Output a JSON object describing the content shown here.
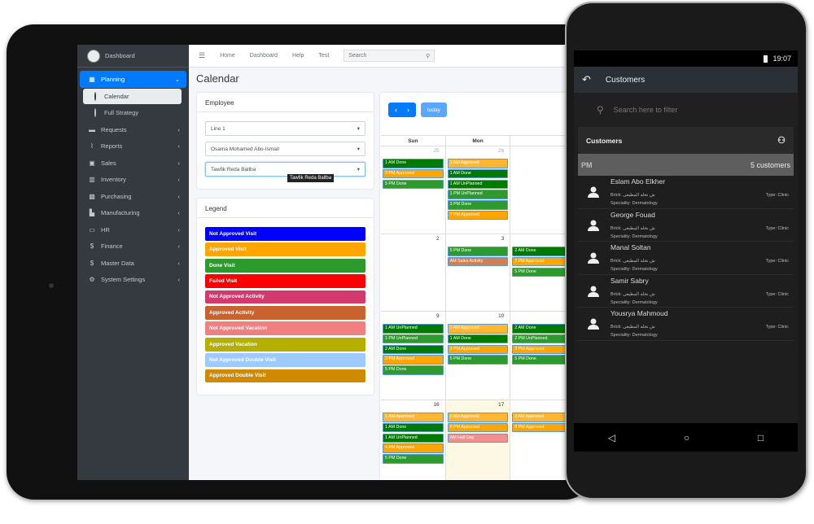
{
  "sidebar": {
    "brand": "Dashboard",
    "items": [
      {
        "label": "Planning",
        "icon": "calendar-icon",
        "glyph": "▦",
        "state": "active",
        "caret": "⌄"
      },
      {
        "label": "Calendar",
        "icon": "circle-icon",
        "state": "sub"
      },
      {
        "label": "Full Strategy",
        "icon": "circle-icon",
        "state": "sub2"
      },
      {
        "label": "Requests",
        "icon": "briefcase-icon",
        "glyph": "▬",
        "caret": "‹"
      },
      {
        "label": "Reports",
        "icon": "chart-icon",
        "glyph": "⌇",
        "caret": "‹"
      },
      {
        "label": "Sales",
        "icon": "id-card-icon",
        "glyph": "▣",
        "caret": "‹"
      },
      {
        "label": "Inventory",
        "icon": "barcode-icon",
        "glyph": "▥",
        "caret": "‹"
      },
      {
        "label": "Purchasing",
        "icon": "boxes-icon",
        "glyph": "▩",
        "caret": "‹"
      },
      {
        "label": "Manufacturing",
        "icon": "industry-icon",
        "glyph": "▙",
        "caret": "‹"
      },
      {
        "label": "HR",
        "icon": "chalkboard-user-icon",
        "glyph": "▭",
        "caret": "‹"
      },
      {
        "label": "Finance",
        "icon": "dollar-icon",
        "glyph": "$",
        "caret": "‹"
      },
      {
        "label": "Master Data",
        "icon": "dollar-icon",
        "glyph": "$",
        "caret": "‹"
      },
      {
        "label": "System Settings",
        "icon": "gear-icon",
        "glyph": "⚙",
        "caret": "‹"
      }
    ]
  },
  "topbar": {
    "links": [
      "Home",
      "Dashboard",
      "Help",
      "Test"
    ],
    "search_placeholder": "Search"
  },
  "page": {
    "title": "Calendar"
  },
  "employee": {
    "title": "Employee",
    "selects": [
      "Line 1",
      "Osama Mohamed Abo-Ismail",
      "Tawfik Reda Ballba"
    ],
    "tooltip": "Tawfik Reda Ballba"
  },
  "legend": {
    "title": "Legend",
    "items": [
      {
        "label": "Not Approved Visit",
        "color": "#0000ff"
      },
      {
        "label": "Approved Visit",
        "color": "#ffa500"
      },
      {
        "label": "Done Visit",
        "color": "#2e9a2e"
      },
      {
        "label": "Failed Visit",
        "color": "#ff0000"
      },
      {
        "label": "Not Approved Activity",
        "color": "#d23a6e"
      },
      {
        "label": "Approved Activity",
        "color": "#c8622e"
      },
      {
        "label": "Not Approved Vacation",
        "color": "#f08080"
      },
      {
        "label": "Approved Vacation",
        "color": "#b5b000"
      },
      {
        "label": "Not Approved Double Visit",
        "color": "#9ecbff"
      },
      {
        "label": "Approved Double Visit",
        "color": "#d08a00"
      }
    ]
  },
  "calendar": {
    "today_label": "today",
    "days": [
      "Sun",
      "Mon",
      ""
    ],
    "weeks": [
      {
        "height": 108,
        "days": [
          {
            "num": "25",
            "other": true,
            "events": [
              [
                "1 AM Done",
                "#007a00"
              ],
              [
                "3 PM Approved",
                "#ffa500"
              ],
              [
                "5 PM Done",
                "#2e9a2e"
              ]
            ]
          },
          {
            "num": "26",
            "other": true,
            "events": [
              [
                "1 AM Approved",
                "#ffb732"
              ],
              [
                "1 AM Done",
                "#007a00"
              ],
              [
                "1 AM UnPlanned",
                "#007a00"
              ],
              [
                "1 PM UnPlanned",
                "#2e9a2e"
              ],
              [
                "3 PM Done",
                "#2e9a2e"
              ],
              [
                "7 PM Approved",
                "#ffa500"
              ]
            ]
          },
          {
            "num": "",
            "events": []
          }
        ]
      },
      {
        "height": 95,
        "days": [
          {
            "num": "2",
            "events": []
          },
          {
            "num": "3",
            "events": [
              [
                "5 PM Done",
                "#2e9a2e"
              ],
              [
                "AM Sales Activity",
                "#d2804f"
              ]
            ]
          },
          {
            "num": "",
            "events": [
              [
                "2 AM Done",
                "#007a00"
              ],
              [
                "2 PM Approved",
                "#ffa500"
              ],
              [
                "5 PM Done",
                "#2e9a2e"
              ]
            ]
          }
        ]
      },
      {
        "height": 109,
        "days": [
          {
            "num": "9",
            "events": [
              [
                "1 AM UnPlanned",
                "#007a00"
              ],
              [
                "1 PM UnPlanned",
                "#2e9a2e"
              ],
              [
                "2 AM Done",
                "#007a00"
              ],
              [
                "3 PM Approved",
                "#ffa500"
              ],
              [
                "5 PM Done",
                "#2e9a2e"
              ]
            ]
          },
          {
            "num": "10",
            "events": [
              [
                "1 AM Approved",
                "#ffb732"
              ],
              [
                "1 AM Done",
                "#007a00"
              ],
              [
                "3 PM Approved",
                "#ffa500"
              ],
              [
                "5 PM Done",
                "#2e9a2e"
              ]
            ]
          },
          {
            "num": "",
            "events": [
              [
                "2 AM Done",
                "#007a00"
              ],
              [
                "2 PM UnPlanned",
                "#2e9a2e"
              ],
              [
                "3 PM Approved",
                "#ffa500"
              ],
              [
                "5 PM Done",
                "#2e9a2e"
              ]
            ]
          }
        ]
      },
      {
        "height": 100,
        "days": [
          {
            "num": "16",
            "events": [
              [
                "1 AM Approved",
                "#ffb732"
              ],
              [
                "1 AM Done",
                "#007a00"
              ],
              [
                "1 AM UnPlanned",
                "#007a00"
              ],
              [
                "4 PM Approved",
                "#ffa500"
              ],
              [
                "5 PM Done",
                "#2e9a2e"
              ]
            ]
          },
          {
            "num": "17",
            "today": true,
            "events": [
              [
                "2 AM Approved",
                "#ffb732"
              ],
              [
                "8 PM Approved",
                "#ffa500"
              ],
              [
                "AM Half Day",
                "#f09090"
              ]
            ]
          },
          {
            "num": "",
            "events": [
              [
                "2 AM Approved",
                "#ffb732"
              ],
              [
                "8 PM Approved",
                "#ffa500"
              ]
            ]
          }
        ]
      }
    ]
  },
  "phone": {
    "time": "19:07",
    "title": "Customers",
    "search_placeholder": "Search here to filter",
    "list_title": "Customers",
    "group": "PM",
    "group_count": "5 customers",
    "customers": [
      {
        "name": "Eslam Abo Elkher",
        "brick": "Brick: ش نخله المطيعى",
        "speciality": "Speciality: Dermatology",
        "type": "Type: Clinic"
      },
      {
        "name": "George Fouad",
        "brick": "Brick: ش نخله المطيعى",
        "speciality": "Speciality: Dermatology",
        "type": "Type: Clinic"
      },
      {
        "name": "Manal Soltan",
        "brick": "Brick: ش نخله المطيعى",
        "speciality": "Speciality: Dermatology",
        "type": "Type: Clinic"
      },
      {
        "name": "Samir Sabry",
        "brick": "Brick: ش نخله المطيعى",
        "speciality": "Speciality: Dermatology",
        "type": "Type: Clinic"
      },
      {
        "name": "Yousrya Mahmoud",
        "brick": "Brick: ش نخله المطيعى",
        "speciality": "Speciality: Dermatology",
        "type": "Type: Clinic"
      }
    ]
  }
}
